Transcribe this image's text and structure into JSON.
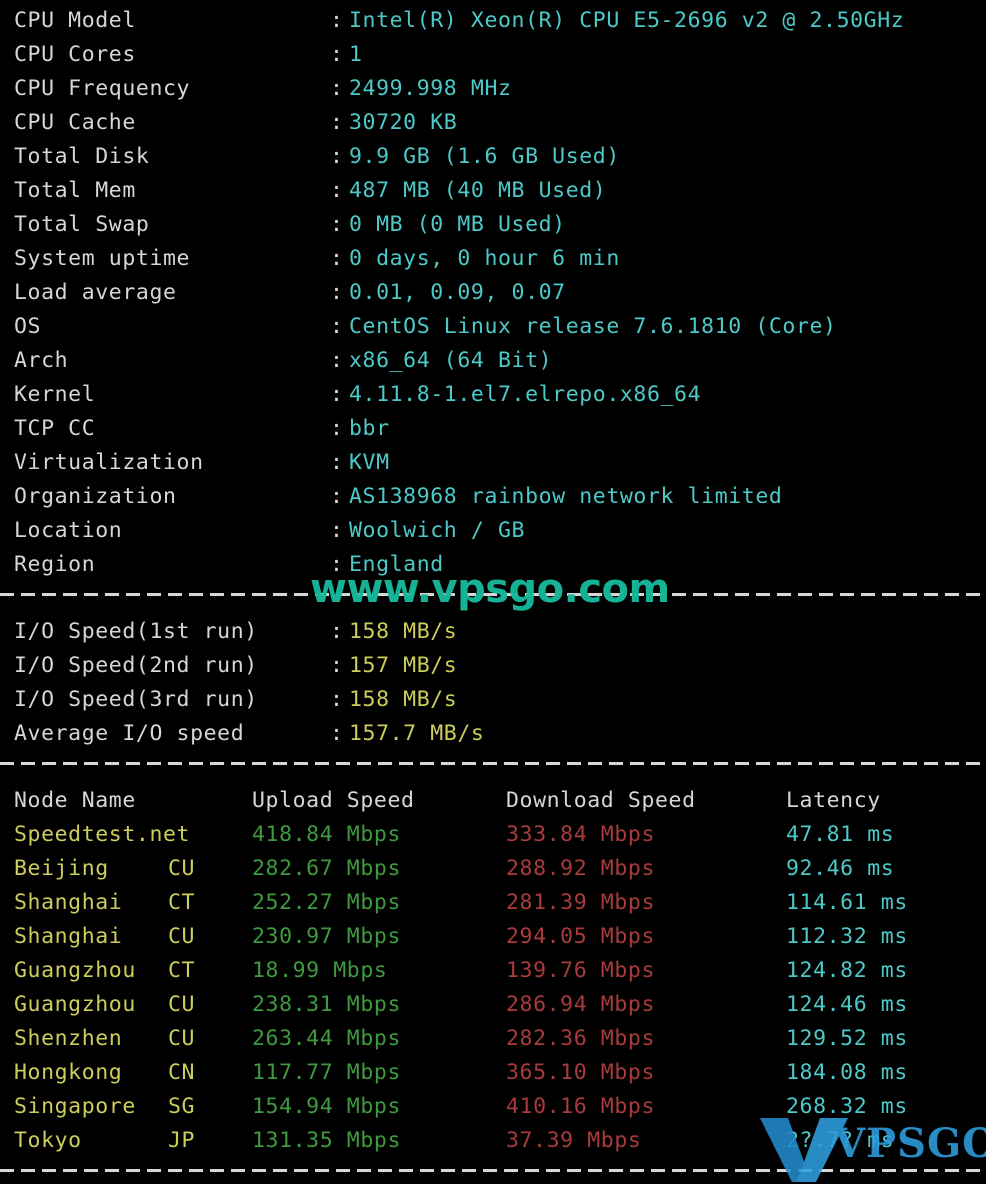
{
  "terminal": {
    "background_color": "#000000",
    "separator_char": "-"
  },
  "colors": {
    "label": "#d6d6d6",
    "value": "#4ec9c9",
    "io_speed": "#cdcd5c",
    "node_name": "#cdcd5c",
    "upload": "#3f9a3f",
    "download": "#a93b3b",
    "latency": "#4ec9c9",
    "header": "#d6d6d6",
    "watermark_text": "#17b89b",
    "watermark_logo": "#2f9fe0"
  },
  "sysinfo": {
    "separator": ":",
    "rows": [
      {
        "label": "CPU Model",
        "value": "Intel(R) Xeon(R) CPU E5-2696 v2 @ 2.50GHz"
      },
      {
        "label": "CPU Cores",
        "value": "1"
      },
      {
        "label": "CPU Frequency",
        "value": "2499.998 MHz"
      },
      {
        "label": "CPU Cache",
        "value": "30720 KB"
      },
      {
        "label": "Total Disk",
        "value": "9.9 GB (1.6 GB Used)"
      },
      {
        "label": "Total Mem",
        "value": "487 MB (40 MB Used)"
      },
      {
        "label": "Total Swap",
        "value": "0 MB (0 MB Used)"
      },
      {
        "label": "System uptime",
        "value": "0 days, 0 hour 6 min"
      },
      {
        "label": "Load average",
        "value": "0.01, 0.09, 0.07"
      },
      {
        "label": "OS",
        "value": "CentOS Linux release 7.6.1810 (Core)"
      },
      {
        "label": "Arch",
        "value": "x86_64 (64 Bit)"
      },
      {
        "label": "Kernel",
        "value": "4.11.8-1.el7.elrepo.x86_64"
      },
      {
        "label": "TCP CC",
        "value": "bbr"
      },
      {
        "label": "Virtualization",
        "value": "KVM"
      },
      {
        "label": "Organization",
        "value": "AS138968 rainbow network limited"
      },
      {
        "label": "Location",
        "value": "Woolwich / GB"
      },
      {
        "label": "Region",
        "value": "England"
      }
    ]
  },
  "iospeed": {
    "separator": ":",
    "rows": [
      {
        "label": "I/O Speed(1st run)",
        "value": "158 MB/s"
      },
      {
        "label": "I/O Speed(2nd run)",
        "value": "157 MB/s"
      },
      {
        "label": "I/O Speed(3rd run)",
        "value": "158 MB/s"
      },
      {
        "label": "Average I/O speed",
        "value": "157.7 MB/s"
      }
    ]
  },
  "nettable": {
    "headers": {
      "node": "Node Name",
      "upload": "Upload Speed",
      "download": "Download Speed",
      "latency": "Latency"
    },
    "rows": [
      {
        "node": "Speedtest.net",
        "code": "",
        "upload": "418.84 Mbps",
        "download": "333.84 Mbps",
        "latency": "47.81 ms"
      },
      {
        "node": "Beijing",
        "code": "CU",
        "upload": "282.67 Mbps",
        "download": "288.92 Mbps",
        "latency": "92.46 ms"
      },
      {
        "node": "Shanghai",
        "code": "CT",
        "upload": "252.27 Mbps",
        "download": "281.39 Mbps",
        "latency": "114.61 ms"
      },
      {
        "node": "Shanghai",
        "code": "CU",
        "upload": "230.97 Mbps",
        "download": "294.05 Mbps",
        "latency": "112.32 ms"
      },
      {
        "node": "Guangzhou",
        "code": "CT",
        "upload": "18.99 Mbps",
        "download": "139.76 Mbps",
        "latency": "124.82 ms"
      },
      {
        "node": "Guangzhou",
        "code": "CU",
        "upload": "238.31 Mbps",
        "download": "286.94 Mbps",
        "latency": "124.46 ms"
      },
      {
        "node": "Shenzhen",
        "code": "CU",
        "upload": "263.44 Mbps",
        "download": "282.36 Mbps",
        "latency": "129.52 ms"
      },
      {
        "node": "Hongkong",
        "code": "CN",
        "upload": "117.77 Mbps",
        "download": "365.10 Mbps",
        "latency": "184.08 ms"
      },
      {
        "node": "Singapore",
        "code": "SG",
        "upload": "154.94 Mbps",
        "download": "410.16 Mbps",
        "latency": "268.32 ms"
      },
      {
        "node": "Tokyo",
        "code": "JP",
        "upload": "131.35 Mbps",
        "download": "37.39 Mbps",
        "latency": "2?.7? ms"
      }
    ]
  },
  "watermark": {
    "url_text": "www.vpsgo.com",
    "logo_text": "VPSGO"
  }
}
